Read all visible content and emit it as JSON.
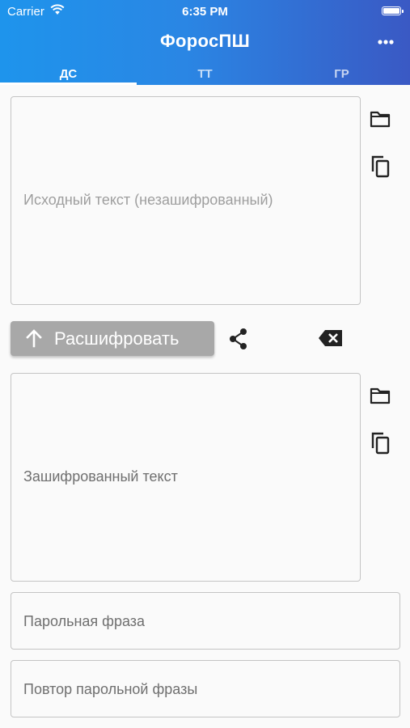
{
  "status_bar": {
    "carrier": "Carrier",
    "time": "6:35 PM"
  },
  "app_bar": {
    "title": "ФоросПШ"
  },
  "tabs": [
    {
      "label": "ДС",
      "selected": true
    },
    {
      "label": "ТТ",
      "selected": false
    },
    {
      "label": "ГР",
      "selected": false
    }
  ],
  "source_field": {
    "placeholder": "Исходный текст (незашифрованный)"
  },
  "decrypt_button": {
    "label": "Расшифровать"
  },
  "encrypted_field": {
    "label": "Зашифрованный текст"
  },
  "passphrase_field": {
    "label": "Парольная фраза"
  },
  "repeat_passphrase_field": {
    "label": "Повтор парольной фразы"
  },
  "colors": {
    "app_bar_gradient_start": "#1e94ec",
    "app_bar_gradient_end": "#3a59c4",
    "button_disabled": "#a8a8a8",
    "background": "#fafafa"
  },
  "icons": [
    "wifi-icon",
    "battery-icon",
    "more-vert-icon",
    "folder-icon",
    "copy-icon",
    "arrow-up-icon",
    "share-icon",
    "backspace-icon"
  ]
}
